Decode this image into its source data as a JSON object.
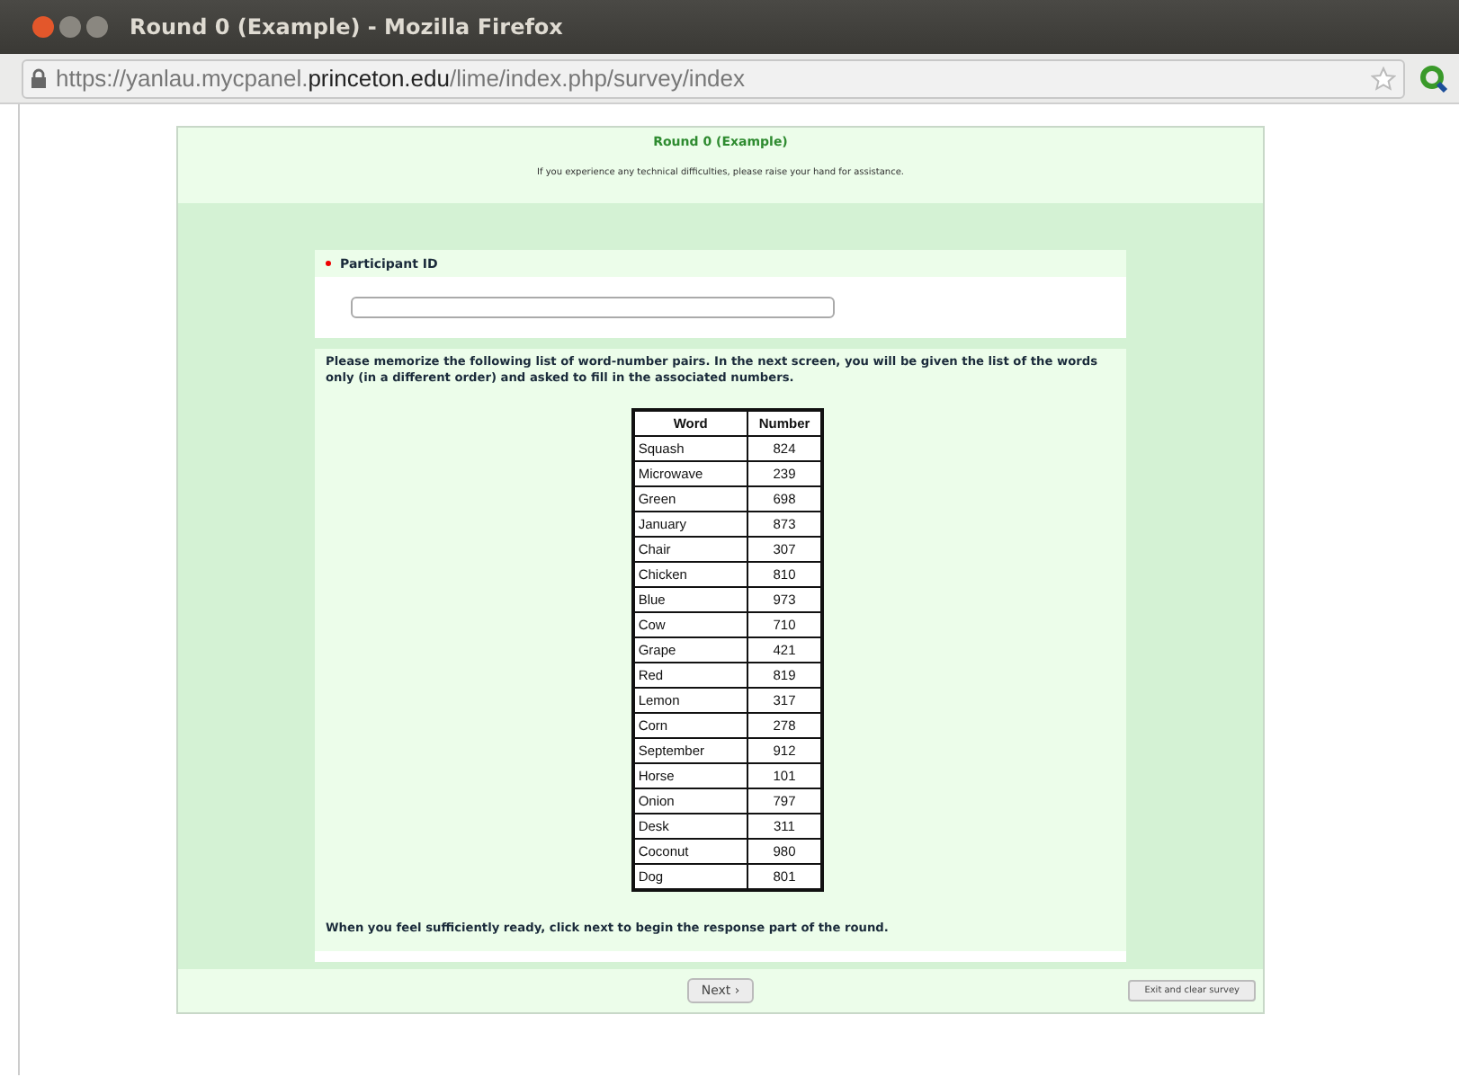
{
  "window": {
    "title": "Round 0 (Example) - Mozilla Firefox"
  },
  "address_bar": {
    "prefix": "https://yanlau.mycpanel.",
    "domain": "princeton.edu",
    "path": "/lime/index.php/survey/index"
  },
  "survey": {
    "title": "Round 0 (Example)",
    "notice": "If you experience any technical difficulties, please raise your hand for assistance."
  },
  "question": {
    "label": "Participant ID",
    "required": true
  },
  "instructions": "Please memorize the following list of word-number pairs. In the next screen, you will be given the list of the words only (in a different order) and asked to fill in the associated numbers.",
  "table": {
    "columns": [
      "Word",
      "Number"
    ],
    "rows": [
      [
        "Squash",
        "824"
      ],
      [
        "Microwave",
        "239"
      ],
      [
        "Green",
        "698"
      ],
      [
        "January",
        "873"
      ],
      [
        "Chair",
        "307"
      ],
      [
        "Chicken",
        "810"
      ],
      [
        "Blue",
        "973"
      ],
      [
        "Cow",
        "710"
      ],
      [
        "Grape",
        "421"
      ],
      [
        "Red",
        "819"
      ],
      [
        "Lemon",
        "317"
      ],
      [
        "Corn",
        "278"
      ],
      [
        "September",
        "912"
      ],
      [
        "Horse",
        "101"
      ],
      [
        "Onion",
        "797"
      ],
      [
        "Desk",
        "311"
      ],
      [
        "Coconut",
        "980"
      ],
      [
        "Dog",
        "801"
      ]
    ]
  },
  "closing": "When you feel sufficiently ready, click next to begin the response part of the round.",
  "buttons": {
    "next": "Next ›",
    "exit": "Exit and clear survey"
  }
}
